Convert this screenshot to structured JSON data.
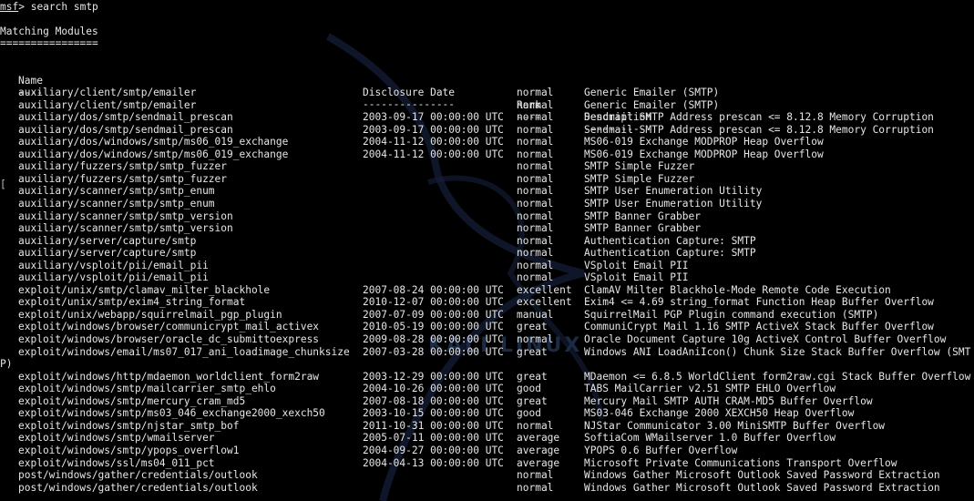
{
  "prompt": {
    "shell": "msf",
    "symbol": "> ",
    "command": "search smtp"
  },
  "section_title": "Matching Modules",
  "section_underline": "================",
  "columns": {
    "name": "Name",
    "date": "Disclosure Date",
    "rank": "Rank",
    "desc": "Description",
    "name_sep": "----",
    "date_sep": "---------------",
    "rank_sep": "----",
    "desc_sep": "-----------"
  },
  "rows": [
    {
      "name": "auxiliary/client/smtp/emailer",
      "date": "",
      "rank": "normal",
      "desc": "Generic Emailer (SMTP)"
    },
    {
      "name": "auxiliary/client/smtp/emailer",
      "date": "",
      "rank": "normal",
      "desc": "Generic Emailer (SMTP)"
    },
    {
      "name": "auxiliary/dos/smtp/sendmail_prescan",
      "date": "2003-09-17 00:00:00 UTC",
      "rank": "normal",
      "desc": "Sendmail SMTP Address prescan <= 8.12.8 Memory Corruption"
    },
    {
      "name": "auxiliary/dos/smtp/sendmail_prescan",
      "date": "2003-09-17 00:00:00 UTC",
      "rank": "normal",
      "desc": "Sendmail SMTP Address prescan <= 8.12.8 Memory Corruption"
    },
    {
      "name": "auxiliary/dos/windows/smtp/ms06_019_exchange",
      "date": "2004-11-12 00:00:00 UTC",
      "rank": "normal",
      "desc": "MS06-019 Exchange MODPROP Heap Overflow"
    },
    {
      "name": "auxiliary/dos/windows/smtp/ms06_019_exchange",
      "date": "2004-11-12 00:00:00 UTC",
      "rank": "normal",
      "desc": "MS06-019 Exchange MODPROP Heap Overflow"
    },
    {
      "name": "auxiliary/fuzzers/smtp/smtp_fuzzer",
      "date": "",
      "rank": "normal",
      "desc": "SMTP Simple Fuzzer"
    },
    {
      "name": "auxiliary/fuzzers/smtp/smtp_fuzzer",
      "date": "",
      "rank": "normal",
      "desc": "SMTP Simple Fuzzer"
    },
    {
      "name": "auxiliary/scanner/smtp/smtp_enum",
      "date": "",
      "rank": "normal",
      "desc": "SMTP User Enumeration Utility"
    },
    {
      "name": "auxiliary/scanner/smtp/smtp_enum",
      "date": "",
      "rank": "normal",
      "desc": "SMTP User Enumeration Utility"
    },
    {
      "name": "auxiliary/scanner/smtp/smtp_version",
      "date": "",
      "rank": "normal",
      "desc": "SMTP Banner Grabber"
    },
    {
      "name": "auxiliary/scanner/smtp/smtp_version",
      "date": "",
      "rank": "normal",
      "desc": "SMTP Banner Grabber"
    },
    {
      "name": "auxiliary/server/capture/smtp",
      "date": "",
      "rank": "normal",
      "desc": "Authentication Capture: SMTP"
    },
    {
      "name": "auxiliary/server/capture/smtp",
      "date": "",
      "rank": "normal",
      "desc": "Authentication Capture: SMTP"
    },
    {
      "name": "auxiliary/vsploit/pii/email_pii",
      "date": "",
      "rank": "normal",
      "desc": "VSploit Email PII"
    },
    {
      "name": "auxiliary/vsploit/pii/email_pii",
      "date": "",
      "rank": "normal",
      "desc": "VSploit Email PII"
    },
    {
      "name": "exploit/unix/smtp/clamav_milter_blackhole",
      "date": "2007-08-24 00:00:00 UTC",
      "rank": "excellent",
      "desc": "ClamAV Milter Blackhole-Mode Remote Code Execution"
    },
    {
      "name": "exploit/unix/smtp/exim4_string_format",
      "date": "2010-12-07 00:00:00 UTC",
      "rank": "excellent",
      "desc": "Exim4 <= 4.69 string_format Function Heap Buffer Overflow"
    },
    {
      "name": "exploit/unix/webapp/squirrelmail_pgp_plugin",
      "date": "2007-07-09 00:00:00 UTC",
      "rank": "manual",
      "desc": "SquirrelMail PGP Plugin command execution (SMTP)"
    },
    {
      "name": "exploit/windows/browser/communicrypt_mail_activex",
      "date": "2010-05-19 00:00:00 UTC",
      "rank": "great",
      "desc": "CommuniCrypt Mail 1.16 SMTP ActiveX Stack Buffer Overflow"
    },
    {
      "name": "exploit/windows/browser/oracle_dc_submittoexpress",
      "date": "2009-08-28 00:00:00 UTC",
      "rank": "normal",
      "desc": "Oracle Document Capture 10g ActiveX Control Buffer Overflow"
    },
    {
      "name": "exploit/windows/email/ms07_017_ani_loadimage_chunksize",
      "date": "2007-03-28 00:00:00 UTC",
      "rank": "great",
      "desc": "Windows ANI LoadAniIcon() Chunk Size Stack Buffer Overflow (SMT"
    },
    {
      "name": "exploit/windows/http/mdaemon_worldclient_form2raw",
      "date": "2003-12-29 00:00:00 UTC",
      "rank": "great",
      "desc": "MDaemon <= 6.8.5 WorldClient form2raw.cgi Stack Buffer Overflow"
    },
    {
      "name": "exploit/windows/smtp/mailcarrier_smtp_ehlo",
      "date": "2004-10-26 00:00:00 UTC",
      "rank": "good",
      "desc": "TABS MailCarrier v2.51 SMTP EHLO Overflow"
    },
    {
      "name": "exploit/windows/smtp/mercury_cram_md5",
      "date": "2007-08-18 00:00:00 UTC",
      "rank": "great",
      "desc": "Mercury Mail SMTP AUTH CRAM-MD5 Buffer Overflow"
    },
    {
      "name": "exploit/windows/smtp/ms03_046_exchange2000_xexch50",
      "date": "2003-10-15 00:00:00 UTC",
      "rank": "good",
      "desc": "MS03-046 Exchange 2000 XEXCH50 Heap Overflow"
    },
    {
      "name": "exploit/windows/smtp/njstar_smtp_bof",
      "date": "2011-10-31 00:00:00 UTC",
      "rank": "normal",
      "desc": "NJStar Communicator 3.00 MiniSMTP Buffer Overflow"
    },
    {
      "name": "exploit/windows/smtp/wmailserver",
      "date": "2005-07-11 00:00:00 UTC",
      "rank": "average",
      "desc": "SoftiaCom WMailserver 1.0 Buffer Overflow"
    },
    {
      "name": "exploit/windows/smtp/ypops_overflow1",
      "date": "2004-09-27 00:00:00 UTC",
      "rank": "average",
      "desc": "YPOPS 0.6 Buffer Overflow"
    },
    {
      "name": "exploit/windows/ssl/ms04_011_pct",
      "date": "2004-04-13 00:00:00 UTC",
      "rank": "average",
      "desc": "Microsoft Private Communications Transport Overflow"
    },
    {
      "name": "post/windows/gather/credentials/outlook",
      "date": "",
      "rank": "normal",
      "desc": "Windows Gather Microsoft Outlook Saved Password Extraction"
    },
    {
      "name": "post/windows/gather/credentials/outlook",
      "date": "",
      "rank": "normal",
      "desc": "Windows Gather Microsoft Outlook Saved Password Extraction"
    }
  ],
  "wrap_fragment": "P)",
  "cursor_glyph": "[",
  "watermark_text": "KALI LINUX",
  "colors": {
    "background": "#000000",
    "text": "#e6e6e6",
    "watermark": "#1c2a44"
  }
}
